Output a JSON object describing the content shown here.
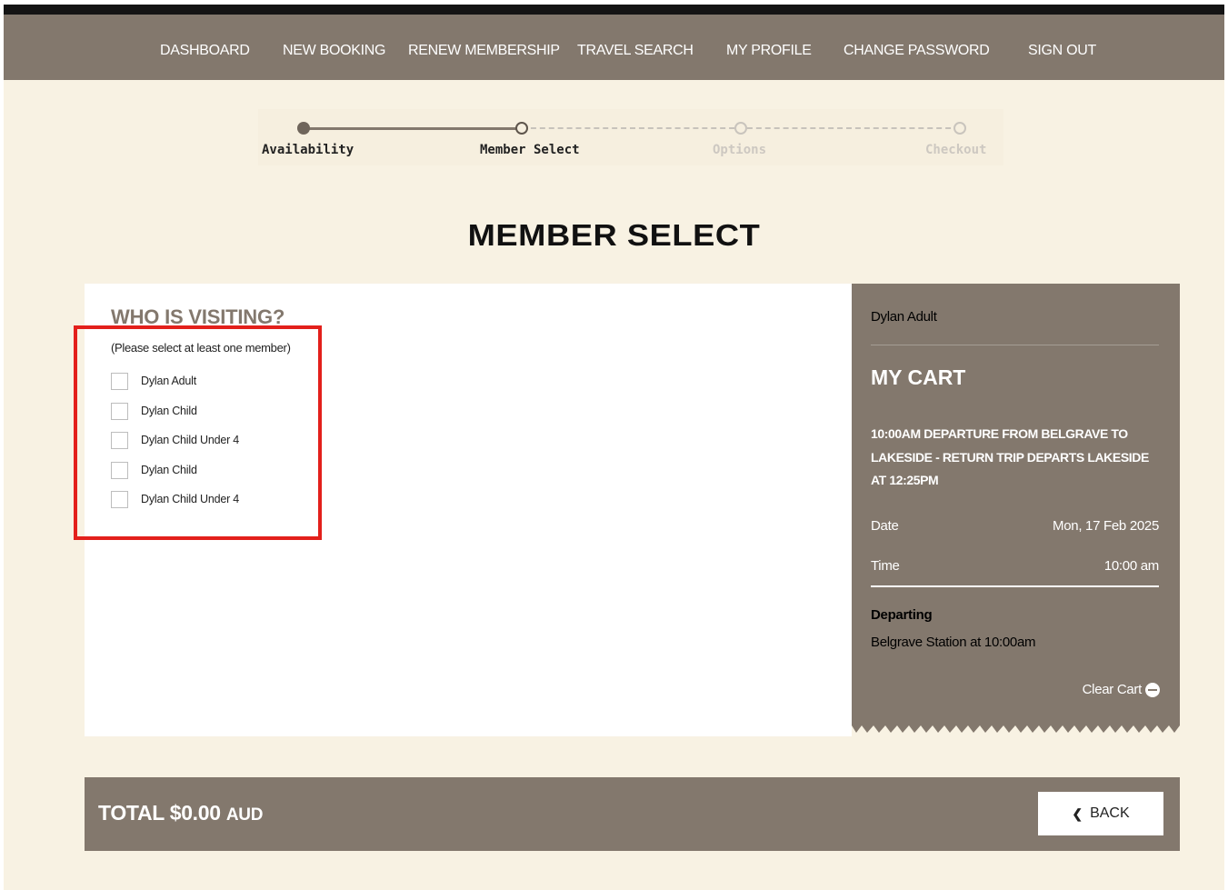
{
  "nav": {
    "items": [
      {
        "label": "DASHBOARD",
        "name": "nav-dashboard"
      },
      {
        "label": "NEW BOOKING",
        "name": "nav-new-booking"
      },
      {
        "label": "RENEW MEMBERSHIP",
        "name": "nav-renew-membership"
      },
      {
        "label": "TRAVEL SEARCH",
        "name": "nav-travel-search"
      },
      {
        "label": "MY PROFILE",
        "name": "nav-my-profile"
      },
      {
        "label": "CHANGE PASSWORD",
        "name": "nav-change-password"
      },
      {
        "label": "SIGN OUT",
        "name": "nav-sign-out"
      }
    ]
  },
  "stepper": {
    "steps": [
      {
        "label": "Availability",
        "state": "complete"
      },
      {
        "label": "Member Select",
        "state": "current"
      },
      {
        "label": "Options",
        "state": "upcoming"
      },
      {
        "label": "Checkout",
        "state": "upcoming"
      }
    ]
  },
  "page": {
    "title": "MEMBER SELECT"
  },
  "members": {
    "title": "WHO IS VISITING?",
    "subtitle": "(Please select at least one member)",
    "list": [
      {
        "label": "Dylan Adult",
        "checked": false
      },
      {
        "label": "Dylan Child",
        "checked": false
      },
      {
        "label": "Dylan Child Under 4",
        "checked": false
      },
      {
        "label": "Dylan Child",
        "checked": false
      },
      {
        "label": "Dylan Child Under 4",
        "checked": false
      }
    ]
  },
  "cart": {
    "user": "Dylan Adult",
    "title": "MY CART",
    "trip": "10:00AM DEPARTURE FROM BELGRAVE TO LAKESIDE - RETURN TRIP DEPARTS LAKESIDE AT 12:25PM",
    "date_label": "Date",
    "date_value": "Mon, 17 Feb 2025",
    "time_label": "Time",
    "time_value": "10:00 am",
    "departing_label": "Departing",
    "departing_value": "Belgrave Station at 10:00am",
    "clear_label": "Clear Cart"
  },
  "footer": {
    "total_label": "TOTAL $0.00",
    "currency": "AUD",
    "back_label": "BACK"
  },
  "colors": {
    "brand": "#83786d",
    "background": "#f8f2e3",
    "highlight": "#e3201b"
  },
  "icons": {
    "checkbox": "checkbox-icon",
    "clear": "minus-circle-icon",
    "back": "chevron-left-icon"
  }
}
